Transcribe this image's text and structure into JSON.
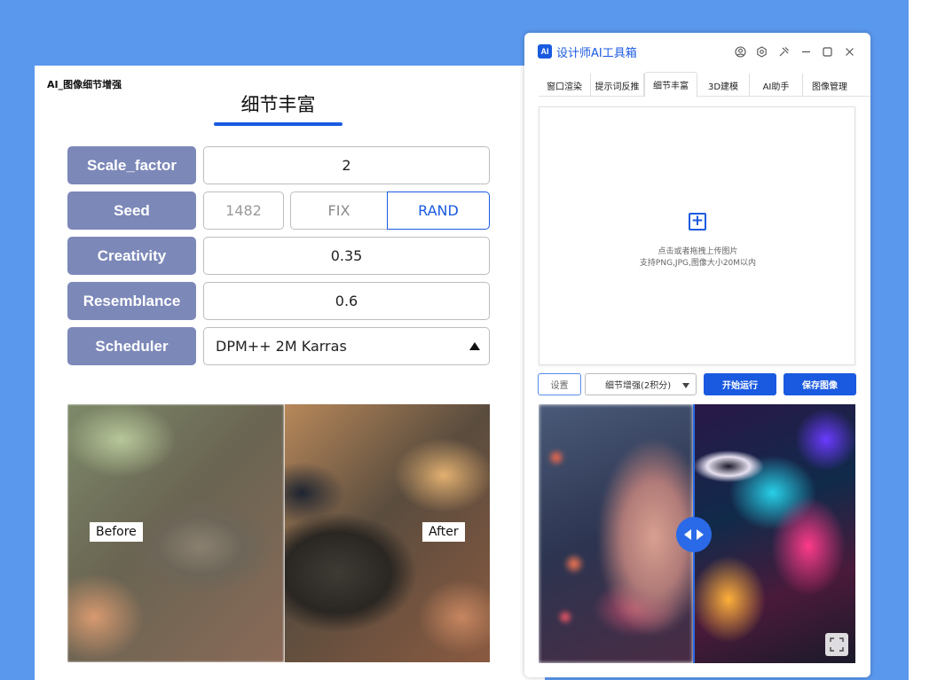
{
  "left_panel": {
    "window_title": "AI_图像细节增强",
    "heading": "细节丰富",
    "params": {
      "scale_factor": {
        "label": "Scale_factor",
        "value": "2"
      },
      "seed": {
        "label": "Seed",
        "value": "1482",
        "fix_label": "FIX",
        "rand_label": "RAND",
        "selected": "RAND"
      },
      "creativity": {
        "label": "Creativity",
        "value": "0.35"
      },
      "resemblance": {
        "label": "Resemblance",
        "value": "0.6"
      },
      "scheduler": {
        "label": "Scheduler",
        "value": "DPM++ 2M Karras"
      }
    },
    "comparison": {
      "before_label": "Before",
      "after_label": "After"
    }
  },
  "app": {
    "logo_text": "AI",
    "title": "设计师AI工具箱",
    "titlebar_icons": [
      "user-icon",
      "settings-icon",
      "pin-icon",
      "minimize-icon",
      "maximize-icon",
      "close-icon"
    ],
    "tabs": [
      {
        "label": "窗口渲染"
      },
      {
        "label": "提示词反推"
      },
      {
        "label": "细节丰富"
      },
      {
        "label": "3D建模"
      },
      {
        "label": "AI助手"
      },
      {
        "label": "图像管理"
      }
    ],
    "active_tab": "细节丰富",
    "upload": {
      "line1": "点击或者拖拽上传图片",
      "line2": "支持PNG,JPG,图像大小20M以内"
    },
    "controls": {
      "settings_label": "设置",
      "mode_select": "细节增强(2积分)",
      "run_label": "开始运行",
      "save_label": "保存图像"
    },
    "colors": {
      "accent": "#1a5ae0",
      "label_bg": "#7c88b8",
      "background": "#5a98ee"
    }
  }
}
